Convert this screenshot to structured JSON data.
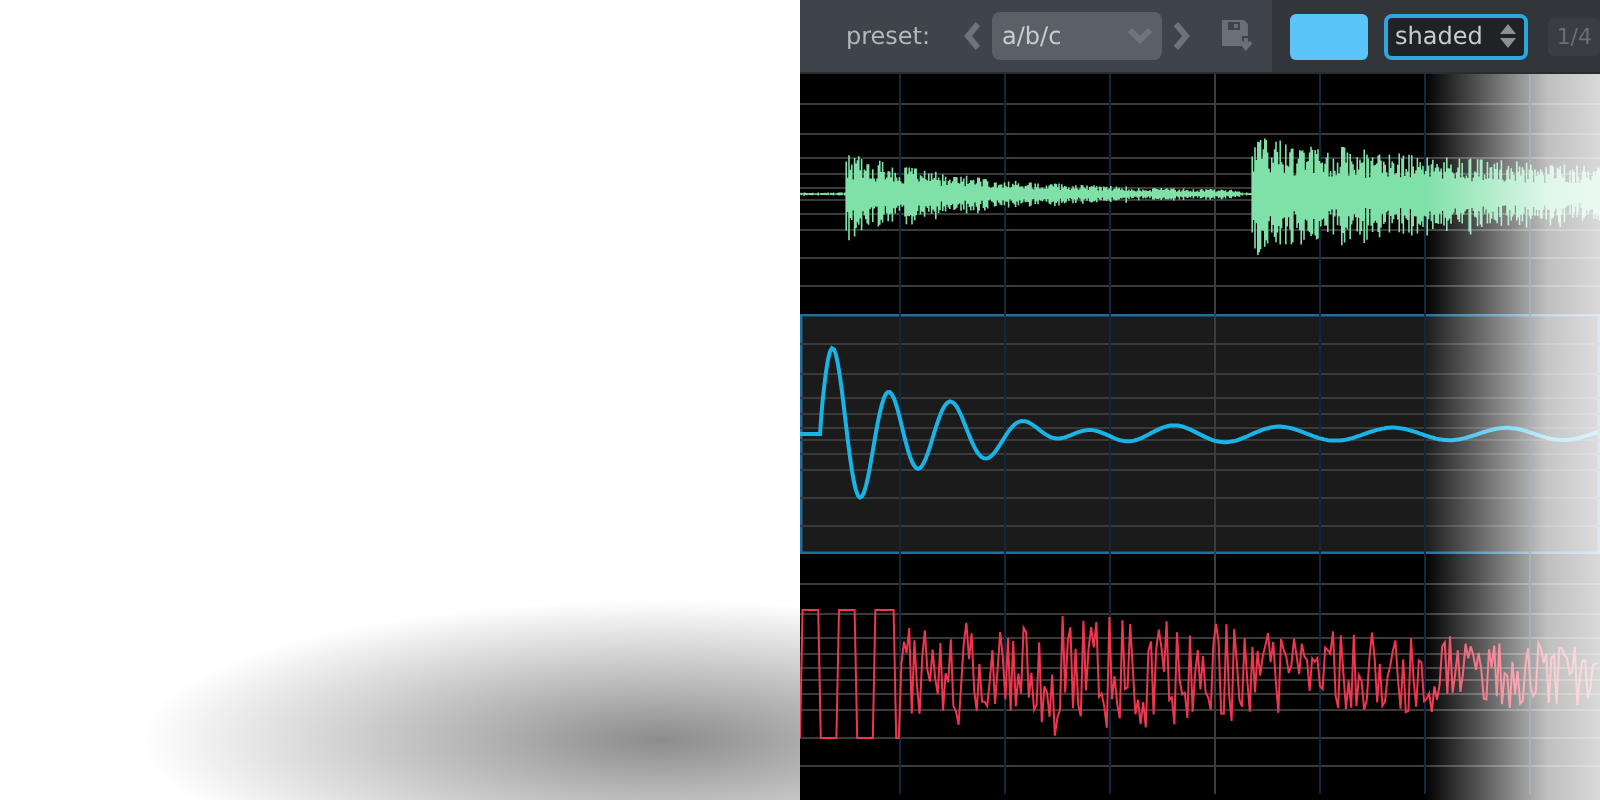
{
  "toolbar": {
    "preset_label": "preset:",
    "preset": {
      "value": "a/b/c"
    },
    "color_swatch": {
      "color": "#5bc4f8"
    },
    "display_mode": {
      "value": "shaded"
    },
    "page": "1/4"
  },
  "tracks": [
    {
      "kind": "envelope",
      "color": "#7fe0a8",
      "selected": false
    },
    {
      "kind": "decay",
      "color": "#19b4e6",
      "selected": true
    },
    {
      "kind": "noise",
      "color": "#f0364e",
      "selected": false
    }
  ]
}
